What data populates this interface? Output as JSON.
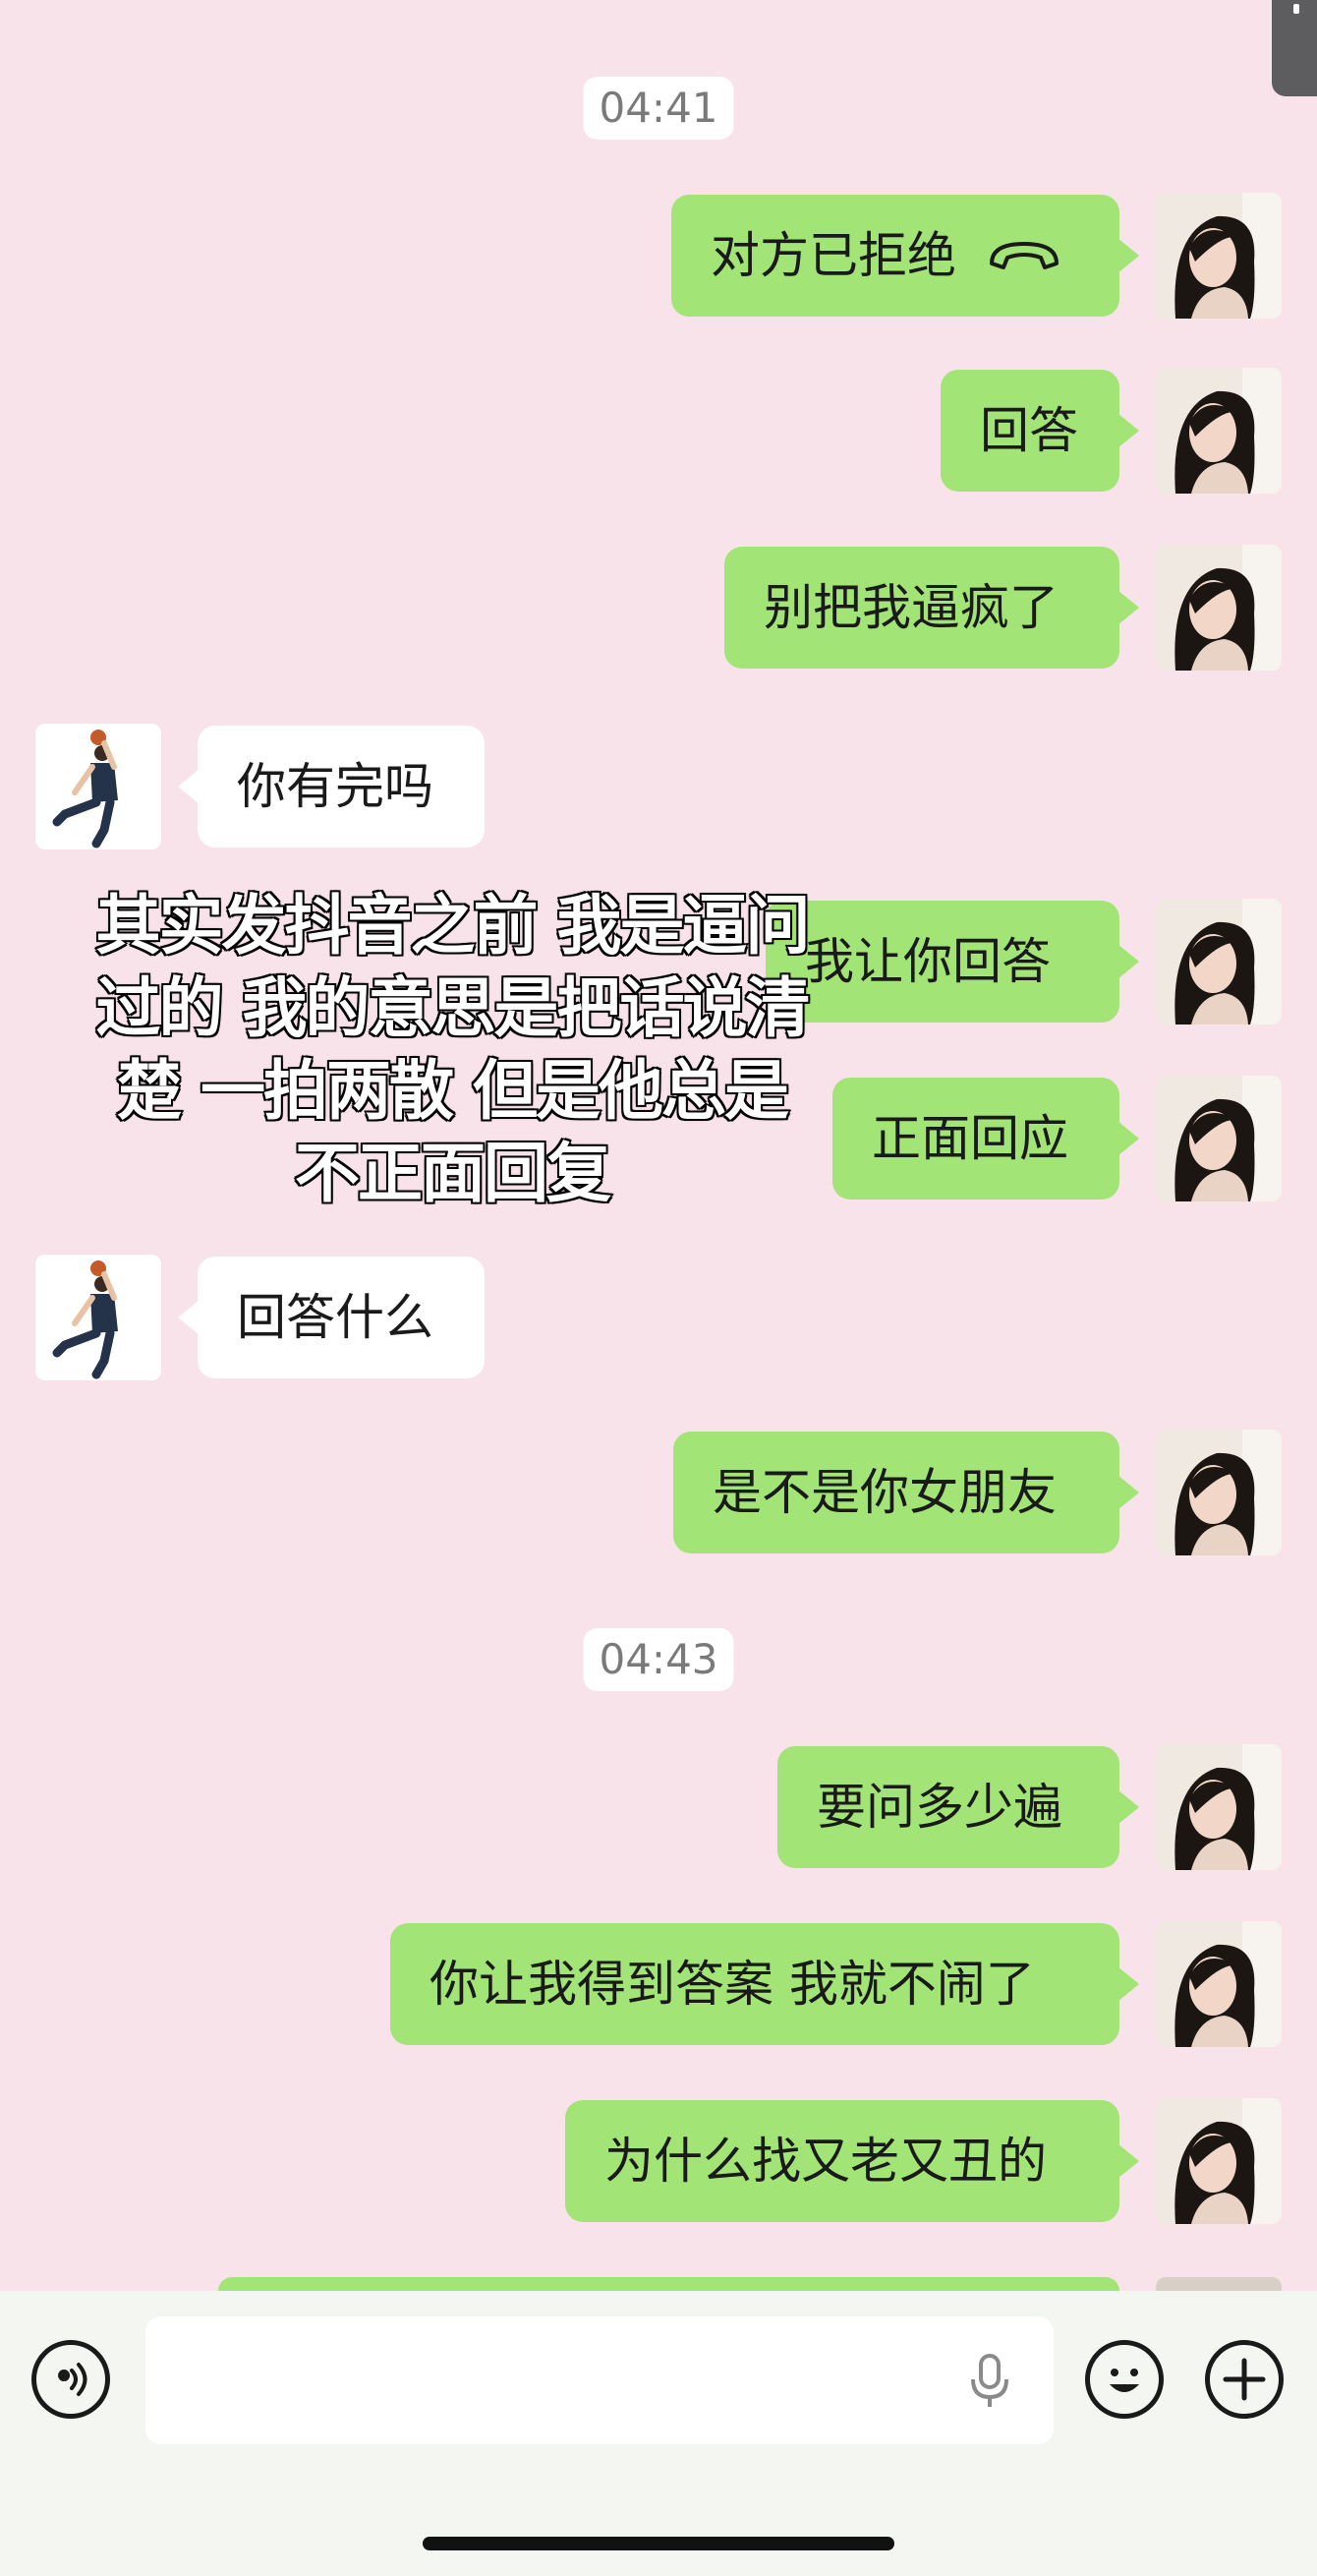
{
  "timestamps": [
    "04:41",
    "04:43"
  ],
  "messages": [
    {
      "side": "me",
      "text": "对方已拒绝",
      "icon": "hang-up-phone-icon"
    },
    {
      "side": "me",
      "text": "回答"
    },
    {
      "side": "me",
      "text": "别把我逼疯了"
    },
    {
      "side": "other",
      "text": "你有完吗"
    },
    {
      "side": "me",
      "text": "我让你回答"
    },
    {
      "side": "me",
      "text": "正面回应"
    },
    {
      "side": "other",
      "text": "回答什么"
    },
    {
      "side": "me",
      "text": "是不是你女朋友"
    },
    {
      "side": "me",
      "text": "要问多少遍"
    },
    {
      "side": "me",
      "text": "你让我得到答案 我就不闹了"
    },
    {
      "side": "me",
      "text": "为什么找又老又丑的"
    }
  ],
  "overlay_caption": [
    "其实发抖音之前 我是逼问",
    "过的 我的意思是把话说清",
    "楚 一拍两散 但是他总是",
    "不正面回复"
  ],
  "input_bar": {
    "voice_icon": "voice-toggle-icon",
    "mic_icon": "microphone-icon",
    "emoji_icon": "emoji-icon",
    "plus_icon": "plus-icon"
  },
  "colors": {
    "background": "#f9e3ea",
    "my_bubble": "#a3e476",
    "their_bubble": "#ffffff"
  }
}
